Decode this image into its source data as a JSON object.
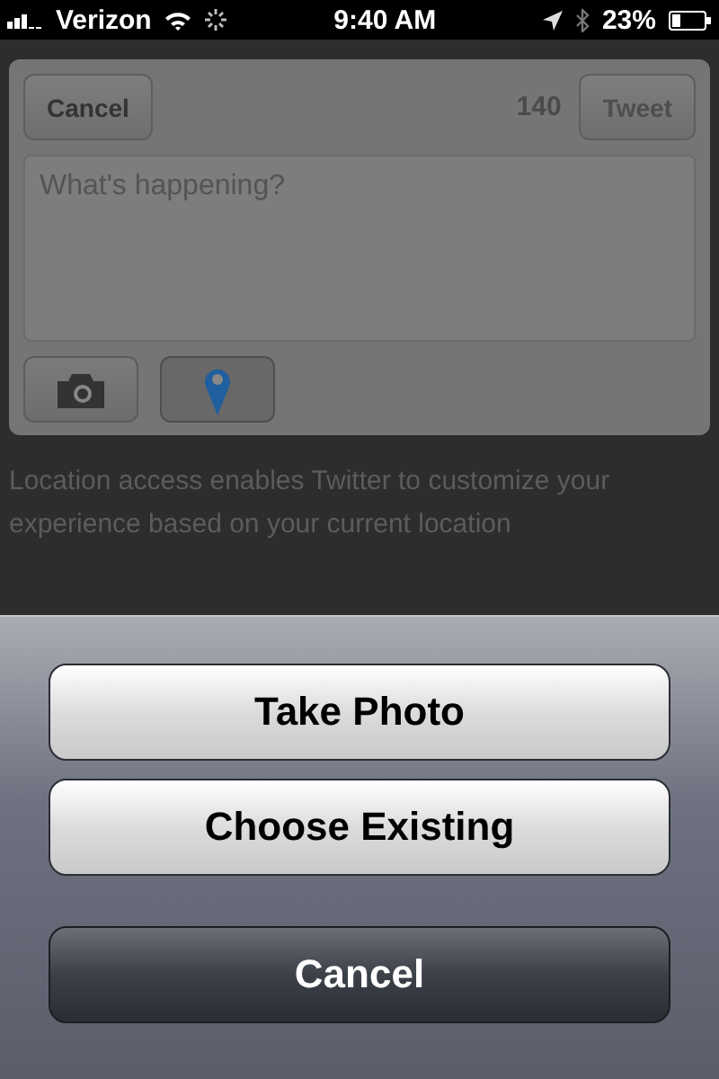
{
  "status_bar": {
    "carrier": "Verizon",
    "time": "9:40 AM",
    "battery": "23%"
  },
  "compose": {
    "cancel": "Cancel",
    "count": "140",
    "tweet": "Tweet",
    "placeholder": "What's happening?",
    "attachments": [
      {
        "kind": "camera",
        "on": false
      },
      {
        "kind": "location",
        "on": true
      }
    ]
  },
  "note": "Location access enables Twitter to customize your experience based on your current location",
  "action_sheet": {
    "buttons": [
      {
        "label": "Take Photo",
        "kind": "option"
      },
      {
        "label": "Choose Existing",
        "kind": "option"
      },
      {
        "label": "Cancel",
        "kind": "cancel"
      }
    ]
  }
}
